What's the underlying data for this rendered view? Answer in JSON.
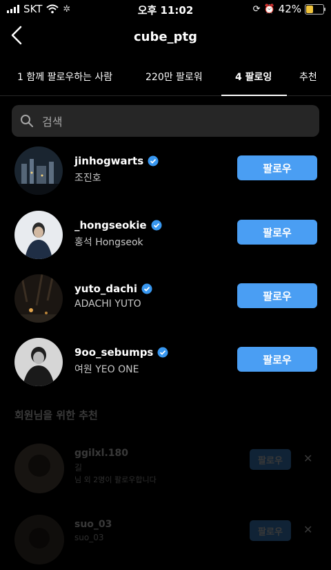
{
  "status_bar": {
    "carrier": "SKT",
    "time": "오후 11:02",
    "battery": "42%"
  },
  "header": {
    "title": "cube_ptg"
  },
  "tabs": [
    {
      "label": "1 함께 팔로우하는 사람"
    },
    {
      "label": "220만 팔로워"
    },
    {
      "label": "4 팔로잉"
    },
    {
      "label": "추천"
    }
  ],
  "search": {
    "placeholder": "검색"
  },
  "following": [
    {
      "username": "jinhogwarts",
      "name": "조진호",
      "button": "팔로우",
      "verified": true
    },
    {
      "username": "_hongseokie",
      "name": "홍석 Hongseok",
      "button": "팔로우",
      "verified": true
    },
    {
      "username": "yuto_dachi",
      "name": "ADACHI YUTO",
      "button": "팔로우",
      "verified": true
    },
    {
      "username": "9oo_sebumps",
      "name": "여원 YEO ONE",
      "button": "팔로우",
      "verified": true
    }
  ],
  "suggestions": {
    "title": "회원님을 위한 추천",
    "items": [
      {
        "username": "ggilxl.180",
        "sub": "길",
        "detail": "님 외 2명이 팔로우합니다",
        "button": "팔로우"
      },
      {
        "username": "suo_03",
        "sub": "suo_03",
        "button": "팔로우"
      }
    ]
  },
  "colors": {
    "accent": "#4a9ef3",
    "background": "#000000",
    "search_bg": "#262626",
    "battery": "#f0c43c"
  }
}
